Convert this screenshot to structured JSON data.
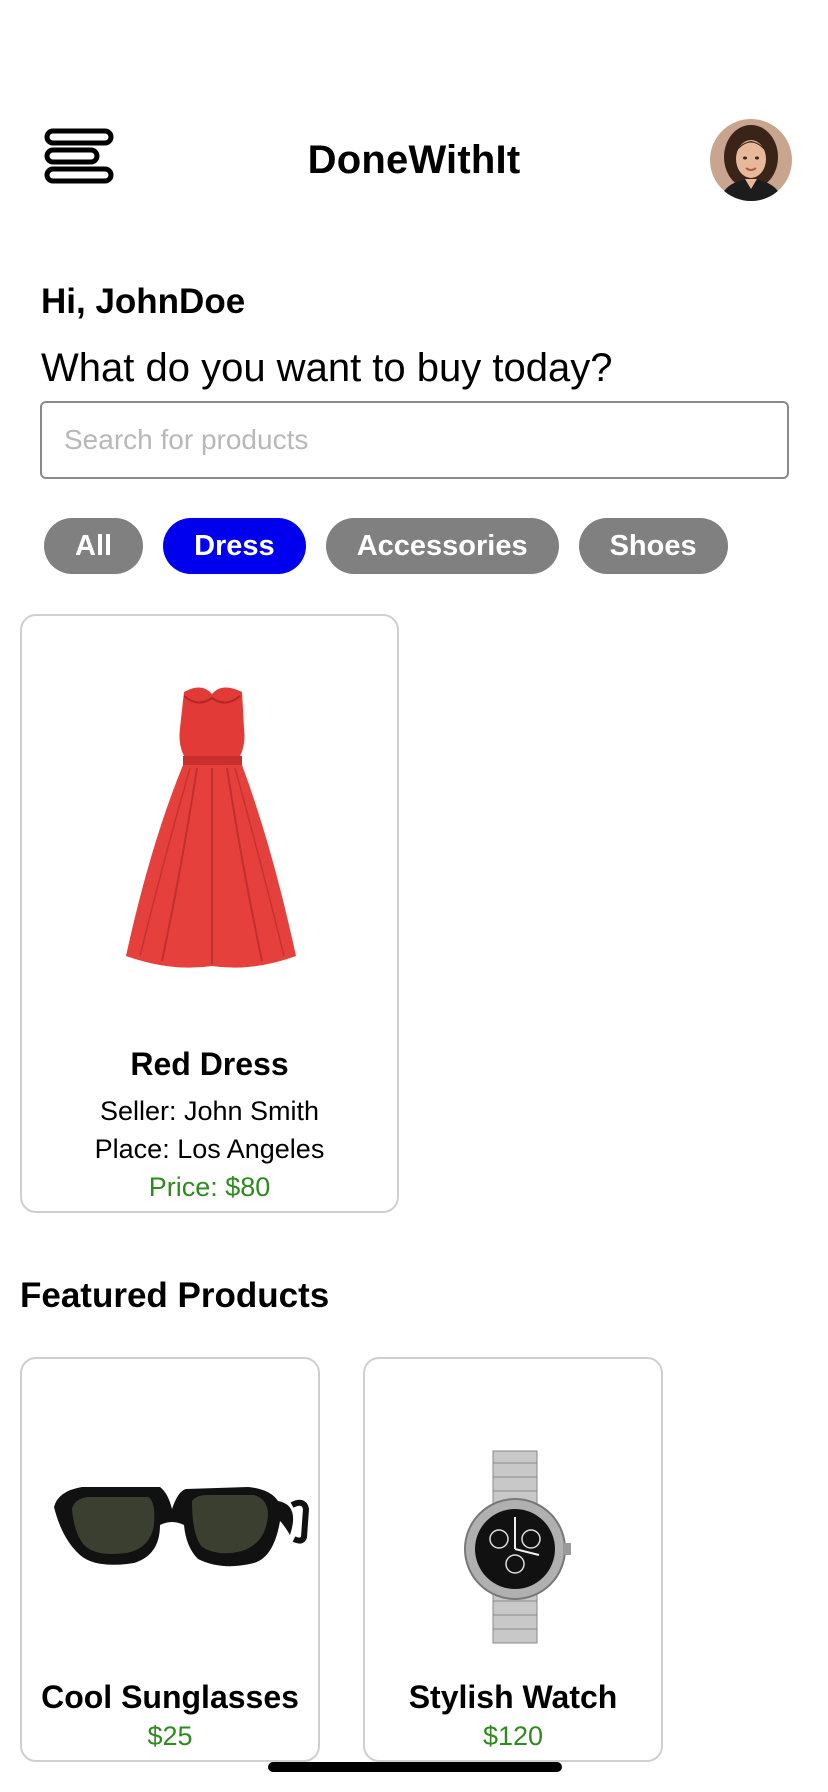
{
  "header": {
    "title": "DoneWithIt",
    "menu_icon": "menu-lines-icon",
    "avatar_icon": "user-avatar"
  },
  "greeting": {
    "hello": "Hi, JohnDoe",
    "question": "What do you want to buy today?"
  },
  "search": {
    "placeholder": "Search for products",
    "value": ""
  },
  "categories": [
    {
      "label": "All",
      "selected": false
    },
    {
      "label": "Dress",
      "selected": true
    },
    {
      "label": "Accessories",
      "selected": false
    },
    {
      "label": "Shoes",
      "selected": false
    }
  ],
  "products": [
    {
      "name": "Red Dress",
      "seller": "Seller: John Smith",
      "place": "Place: Los Angeles",
      "price": "Price: $80",
      "image_icon": "red-dress-image"
    }
  ],
  "featured": {
    "title": "Featured Products",
    "items": [
      {
        "name": "Cool Sunglasses",
        "price": "$25",
        "image_icon": "sunglasses-image"
      },
      {
        "name": "Stylish Watch",
        "price": "$120",
        "image_icon": "watch-image"
      }
    ]
  },
  "colors": {
    "chip_active": "#0000ee",
    "chip_inactive": "#808080",
    "price_green": "#2f8a1f",
    "card_border": "#cfcfcf"
  }
}
